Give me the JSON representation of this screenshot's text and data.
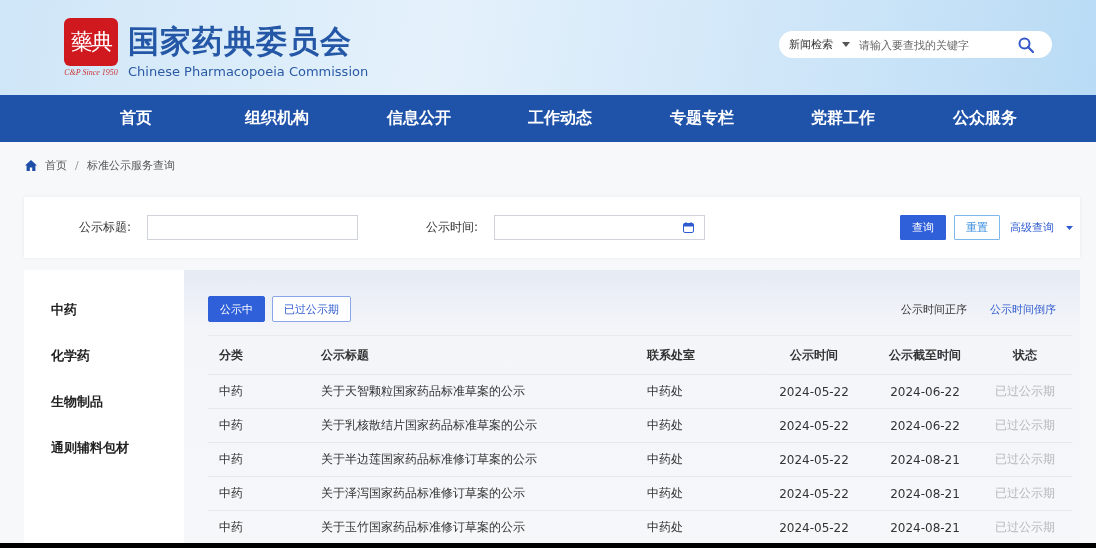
{
  "header": {
    "seal_text": "藥典",
    "seal_caption": "C&P Since 1950",
    "title": "国家药典委员会",
    "subtitle": "Chinese Pharmacopoeia Commission",
    "search": {
      "scope": "新闻检索",
      "placeholder": "请输入要查找的关键字"
    }
  },
  "nav": [
    {
      "label": "首页"
    },
    {
      "label": "组织机构"
    },
    {
      "label": "信息公开"
    },
    {
      "label": "工作动态"
    },
    {
      "label": "专题专栏"
    },
    {
      "label": "党群工作"
    },
    {
      "label": "公众服务"
    }
  ],
  "breadcrumb": {
    "separator": "/",
    "items": [
      "首页",
      "标准公示服务查询"
    ]
  },
  "filter": {
    "fields": [
      {
        "label": "公示标题:",
        "kind": "text"
      },
      {
        "label": "公示时间:",
        "kind": "date"
      }
    ],
    "search_button": "查询",
    "reset_button": "重置",
    "advanced": "高级查询"
  },
  "sidebar": {
    "items": [
      {
        "label": "中药",
        "selected": false
      },
      {
        "label": "化学药",
        "selected": false
      },
      {
        "label": "生物制品",
        "selected": false
      },
      {
        "label": "通则辅料包材",
        "selected": false
      }
    ]
  },
  "tabs": [
    {
      "label": "公示中",
      "selected": true
    },
    {
      "label": "已过公示期",
      "selected": false
    }
  ],
  "sort": [
    {
      "label": "公示时间正序",
      "selected": false
    },
    {
      "label": "公示时间倒序",
      "selected": true
    }
  ],
  "table": {
    "columns": [
      "分类",
      "公示标题",
      "联系处室",
      "公示时间",
      "公示截至时间",
      "状态"
    ],
    "rows": [
      {
        "cells": [
          "中药",
          "关于天智颗粒国家药品标准草案的公示",
          "中药处",
          "2024-05-22",
          "2024-06-22",
          "已过公示期"
        ],
        "expired": true
      },
      {
        "cells": [
          "中药",
          "关于乳核散结片国家药品标准草案的公示",
          "中药处",
          "2024-05-22",
          "2024-06-22",
          "已过公示期"
        ],
        "expired": true
      },
      {
        "cells": [
          "中药",
          "关于半边莲国家药品标准修订草案的公示",
          "中药处",
          "2024-05-22",
          "2024-08-21",
          "已过公示期"
        ],
        "expired": true
      },
      {
        "cells": [
          "中药",
          "关于泽泻国家药品标准修订草案的公示",
          "中药处",
          "2024-05-22",
          "2024-08-21",
          "已过公示期"
        ],
        "expired": true
      },
      {
        "cells": [
          "中药",
          "关于玉竹国家药品标准修订草案的公示",
          "中药处",
          "2024-05-22",
          "2024-08-21",
          "已过公示期"
        ],
        "expired": true
      }
    ]
  }
}
